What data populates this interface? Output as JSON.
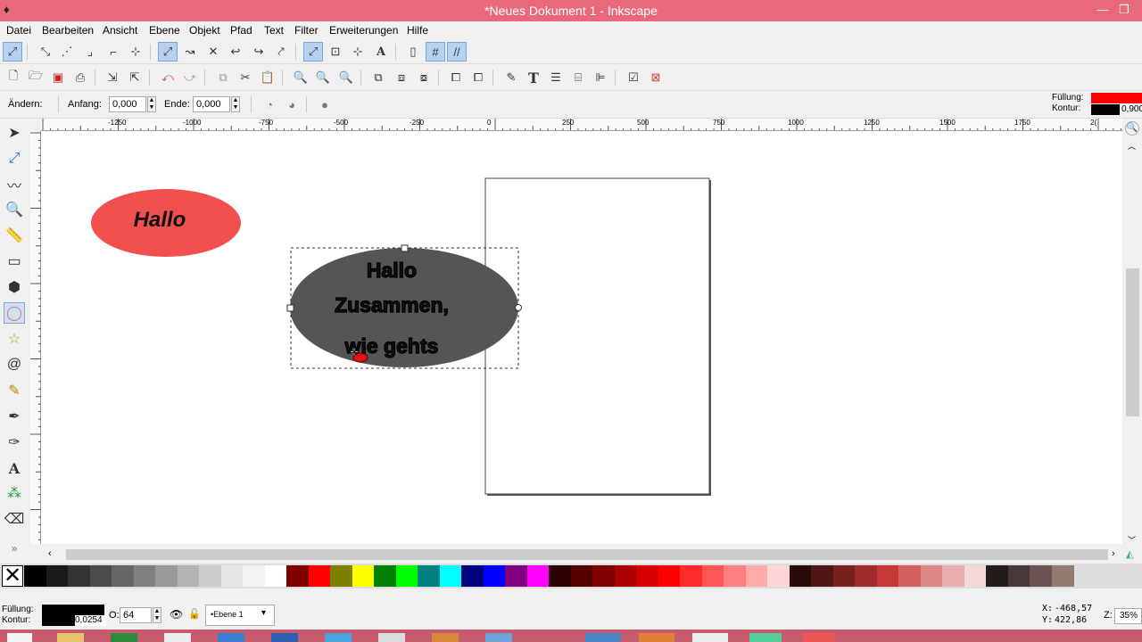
{
  "window": {
    "title": "*Neues Dokument 1 - Inkscape"
  },
  "menu": [
    "Datei",
    "Bearbeiten",
    "Ansicht",
    "Ebene",
    "Objekt",
    "Pfad",
    "Text",
    "Filter",
    "Erweiterungen",
    "Hilfe"
  ],
  "tool_controls": {
    "change_label": "Ändern:",
    "start_label": "Anfang:",
    "start_value": "0,000",
    "end_label": "Ende:",
    "end_value": "0,000"
  },
  "style_indicator": {
    "fill_label": "Füllung:",
    "stroke_label": "Kontur:",
    "stroke_width": "0,900",
    "fill_color": "#ff0000",
    "stroke_color": "#000000"
  },
  "ruler": {
    "labels": [
      "-1250",
      "-1000",
      "-750",
      "-500",
      "-250",
      "0",
      "250",
      "500",
      "750",
      "1000",
      "1250",
      "1500",
      "1750",
      "2("
    ]
  },
  "canvas": {
    "ellipse1": {
      "text": "Hallo",
      "fill": "#f24f4f"
    },
    "ellipse2": {
      "line1": "Hallo",
      "line2": "Zusammen,",
      "line3": "wie  gehts",
      "fill": "#555555"
    }
  },
  "palette": {
    "colors": [
      "#000000",
      "#1a1a1a",
      "#333333",
      "#4d4d4d",
      "#666666",
      "#808080",
      "#999999",
      "#b3b3b3",
      "#cccccc",
      "#e6e6e6",
      "#f2f2f2",
      "#ffffff",
      "#800000",
      "#ff0000",
      "#808000",
      "#ffff00",
      "#008000",
      "#00ff00",
      "#008080",
      "#00ffff",
      "#000080",
      "#0000ff",
      "#800080",
      "#ff00ff",
      "#2b0000",
      "#550000",
      "#800000",
      "#aa0000",
      "#d40000",
      "#ff0000",
      "#ff2a2a",
      "#ff5555",
      "#ff8080",
      "#ffaaaa",
      "#ffd5d5",
      "#280b0b",
      "#501616",
      "#782121",
      "#a02c2c",
      "#c83737",
      "#d35f5f",
      "#de8787",
      "#e9afaf",
      "#f4d7d7",
      "#241c1c",
      "#483737",
      "#6c5353",
      "#917c6f"
    ]
  },
  "status": {
    "fill_label": "Füllung:",
    "stroke_label": "Kontur:",
    "stroke_value": "0,0254",
    "opacity_label": "O:",
    "opacity_value": "64",
    "layer": "•Ebene 1",
    "x_label": "X:",
    "x_value": "-468,57",
    "y_label": "Y:",
    "y_value": "422,86",
    "zoom_label": "Z:",
    "zoom_value": "35%"
  }
}
